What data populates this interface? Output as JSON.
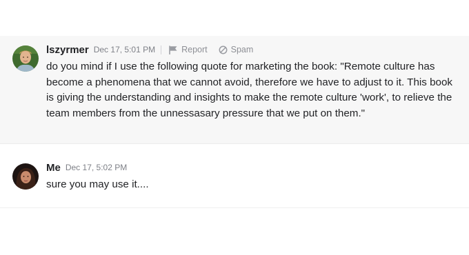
{
  "messages": [
    {
      "username": "lszyrmer",
      "timestamp": "Dec 17, 5:01 PM",
      "actions": {
        "report_label": "Report",
        "spam_label": "Spam",
        "report_icon": "flag-icon",
        "spam_icon": "block-icon"
      },
      "body": "do you mind if I use the following quote for marketing the book: \"Remote culture has become a phenomena that we cannot avoid, therefore we have to adjust to it. This book is giving the understanding and insights to make the remote culture 'work', to relieve the team members from the unnessasary pressure that we put on them.\""
    },
    {
      "username": "Me",
      "timestamp": "Dec 17, 5:02 PM",
      "body": "sure you may use it...."
    }
  ],
  "colors": {
    "highlight_background": "#f7f7f7",
    "text": "#222326",
    "muted": "#7e8087"
  }
}
